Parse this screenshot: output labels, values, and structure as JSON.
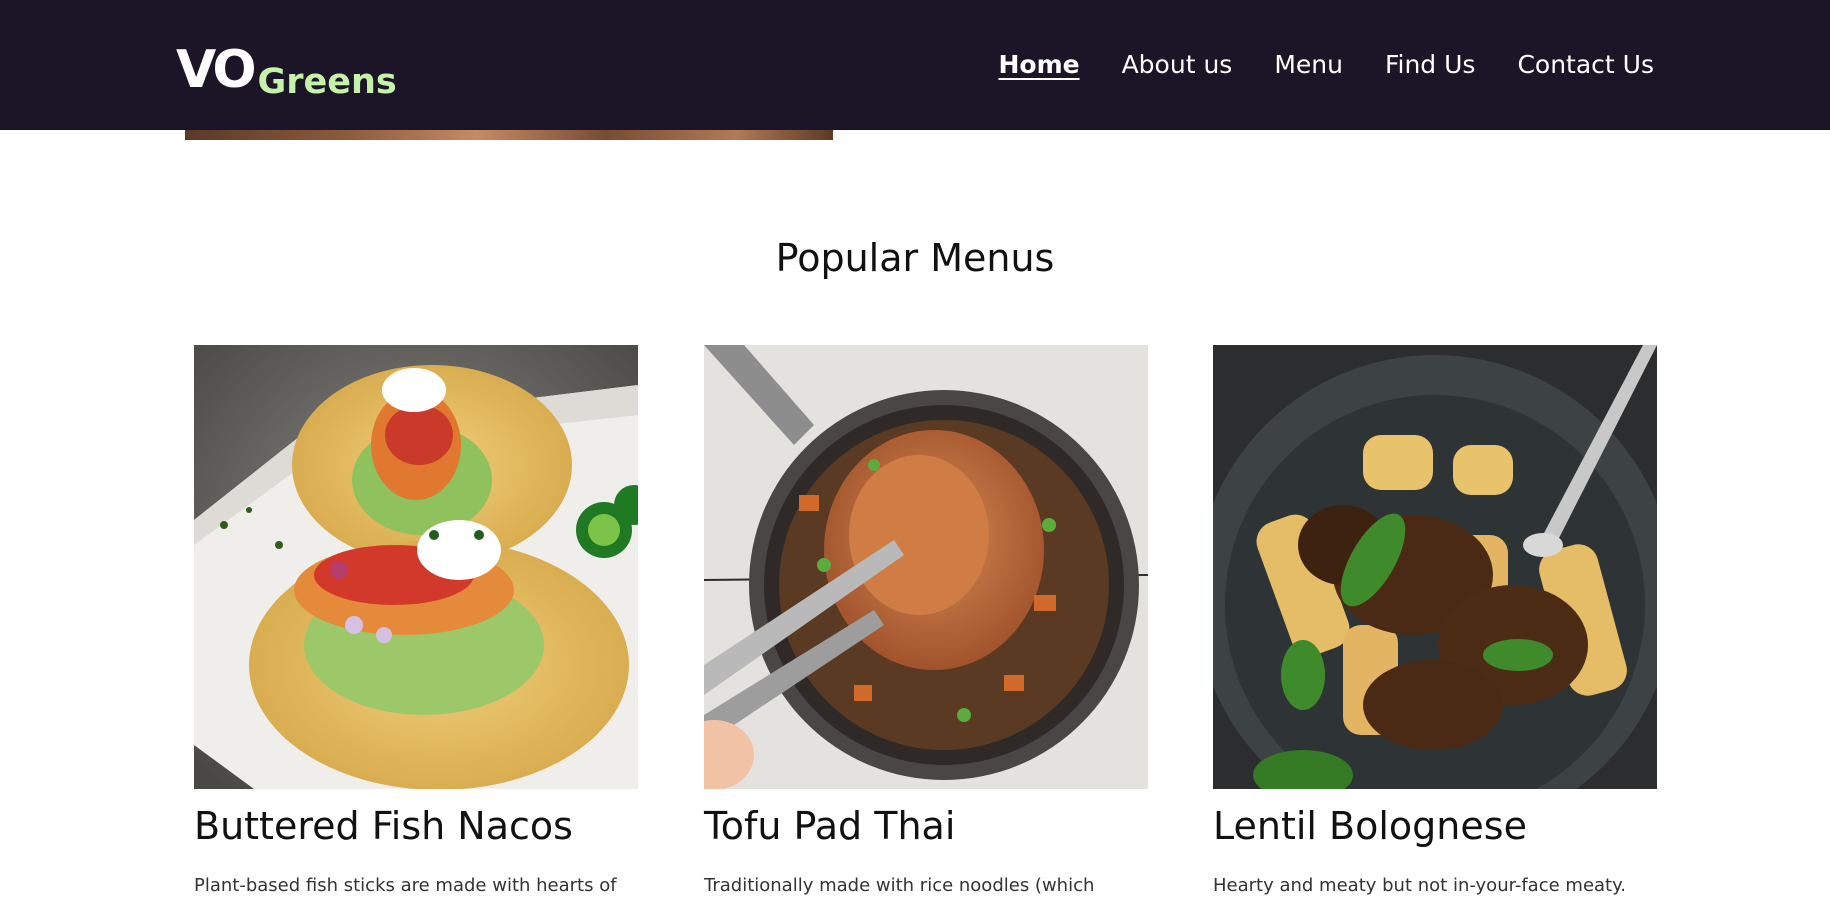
{
  "header": {
    "logo": {
      "primary": "VO",
      "secondary": "Greens"
    },
    "nav": [
      {
        "label": "Home",
        "active": true
      },
      {
        "label": "About us",
        "active": false
      },
      {
        "label": "Menu",
        "active": false
      },
      {
        "label": "Find Us",
        "active": false
      },
      {
        "label": "Contact Us",
        "active": false
      }
    ]
  },
  "colors": {
    "header_bg": "#1c1528",
    "logo_accent": "#c5f2a8",
    "text": "#111111"
  },
  "popular": {
    "title": "Popular Menus",
    "items": [
      {
        "title": "Buttered Fish Nacos",
        "description": "Plant-based fish sticks are made with hearts of",
        "image": "fish-tacos-photo"
      },
      {
        "title": "Tofu Pad Thai",
        "description": "Traditionally made with rice noodles (which",
        "image": "pad-thai-photo"
      },
      {
        "title": "Lentil Bolognese",
        "description": "Hearty and meaty but not in-your-face meaty.",
        "image": "lentil-bolognese-photo"
      }
    ]
  }
}
